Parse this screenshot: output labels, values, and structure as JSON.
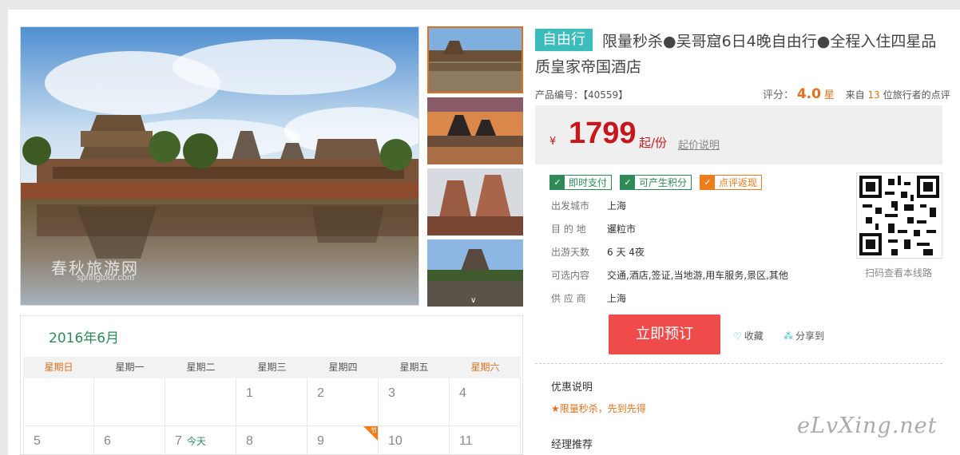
{
  "product": {
    "badge": "自由行",
    "title": "限量秒杀●吴哥窟6日4晚自由行●全程入住四星品质皇家帝国酒店",
    "code_label": "产品编号：",
    "code_value": "【40559】",
    "rating_label": "评分：",
    "rating_value": "4.0",
    "rating_unit": "星",
    "review_prefix": "来自",
    "review_count": "13",
    "review_suffix": "位旅行者的点评"
  },
  "price": {
    "currency": "¥",
    "amount": "1799",
    "unit": "起/份",
    "explain_link": "起价说明"
  },
  "tags": [
    {
      "label": "即时支付",
      "color": "#2e8b57"
    },
    {
      "label": "可产生积分",
      "color": "#2e8b57"
    },
    {
      "label": "点评返现",
      "color": "#f07b1a"
    }
  ],
  "info": [
    {
      "key": "出发城市",
      "value": "上海"
    },
    {
      "key": "目 的 地",
      "value": "暹粒市"
    },
    {
      "key": "出游天数",
      "value": "6 天 4夜"
    },
    {
      "key": "可选内容",
      "value": "交通,酒店,签证,当地游,用车服务,景区,其他"
    },
    {
      "key": "供 应 商",
      "value": "上海"
    }
  ],
  "qr_caption": "扫码查看本线路",
  "actions": {
    "book": "立即预订",
    "favorite": "收藏",
    "share": "分享到"
  },
  "promo": {
    "title": "优惠说明",
    "text": "★限量秒杀，先到先得"
  },
  "manager_title": "经理推荐",
  "watermark": {
    "main": "春秋旅游网",
    "sub": "springtour.com"
  },
  "brand_mark": "eLvXing.net",
  "calendar": {
    "month": "2016年6月",
    "weekdays": [
      "星期日",
      "星期一",
      "星期二",
      "星期三",
      "星期四",
      "星期五",
      "星期六"
    ],
    "row1": [
      "",
      "",
      "",
      "1",
      "2",
      "3",
      "4"
    ],
    "row2": [
      "5",
      "6",
      "7",
      "8",
      "9",
      "10",
      "11"
    ],
    "today_label": "今天",
    "holiday_mark": "节"
  },
  "colors": {
    "accent_green": "#2e8b57",
    "accent_orange": "#e0701e",
    "price_red": "#c8161d",
    "book_button": "#ef4b4b",
    "teal": "#3bbdbd"
  }
}
